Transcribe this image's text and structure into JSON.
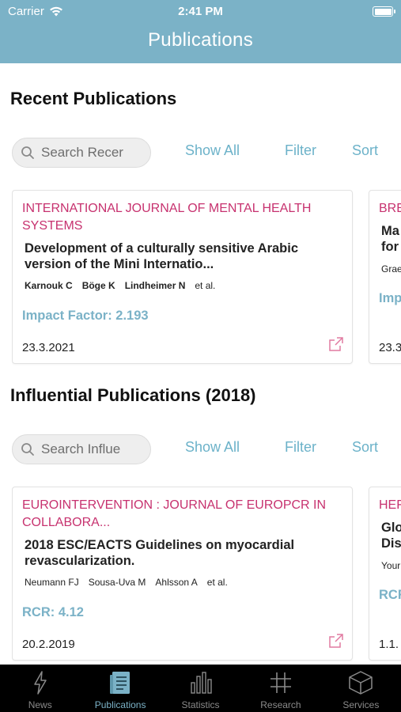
{
  "status_bar": {
    "carrier": "Carrier",
    "time": "2:41 PM"
  },
  "header": {
    "title": "Publications"
  },
  "sections": [
    {
      "title": "Recent Publications",
      "search_placeholder": "Search Recer",
      "show_all": "Show All",
      "filter": "Filter",
      "sort": "Sort",
      "cards": [
        {
          "journal": "INTERNATIONAL JOURNAL OF MENTAL HEALTH SYSTEMS",
          "title": "Development of a culturally sensitive Arabic version of the Mini Internatio...",
          "authors": [
            "Karnouk C",
            "Böge K",
            "Lindheimer N"
          ],
          "etal": "et al.",
          "metric": "Impact Factor: 2.193",
          "date": "23.3.2021"
        },
        {
          "journal": "BRE",
          "title_lines": [
            "Ma",
            "for"
          ],
          "authors": [
            "Grae"
          ],
          "metric": "Imp",
          "date": "23.3"
        }
      ]
    },
    {
      "title": "Influential Publications (2018)",
      "search_placeholder": "Search Influe",
      "show_all": "Show All",
      "filter": "Filter",
      "sort": "Sort",
      "cards": [
        {
          "journal": "EUROINTERVENTION : JOURNAL OF EUROPCR IN COLLABORA...",
          "title": "2018 ESC/EACTS Guidelines on myocardial revascularization.",
          "authors": [
            "Neumann FJ",
            "Sousa-Uva M",
            "Ahlsson A"
          ],
          "etal": "et al.",
          "metric": "RCR: 4.12",
          "date": "20.2.2019"
        },
        {
          "journal": "HEF",
          "title_lines": [
            "Glo",
            "Dis"
          ],
          "authors": [
            "Your"
          ],
          "metric": "RCR",
          "date": "1.1."
        }
      ]
    }
  ],
  "tabbar": [
    {
      "label": "News",
      "icon": "lightning-icon"
    },
    {
      "label": "Publications",
      "icon": "document-icon"
    },
    {
      "label": "Statistics",
      "icon": "bar-chart-icon"
    },
    {
      "label": "Research",
      "icon": "hash-icon"
    },
    {
      "label": "Services",
      "icon": "cube-icon"
    }
  ],
  "active_tab": "Publications",
  "colors": {
    "header": "#7bb2c7",
    "journal": "#c7326f",
    "accent": "#6cb2c9",
    "tabbar": "#000000"
  }
}
